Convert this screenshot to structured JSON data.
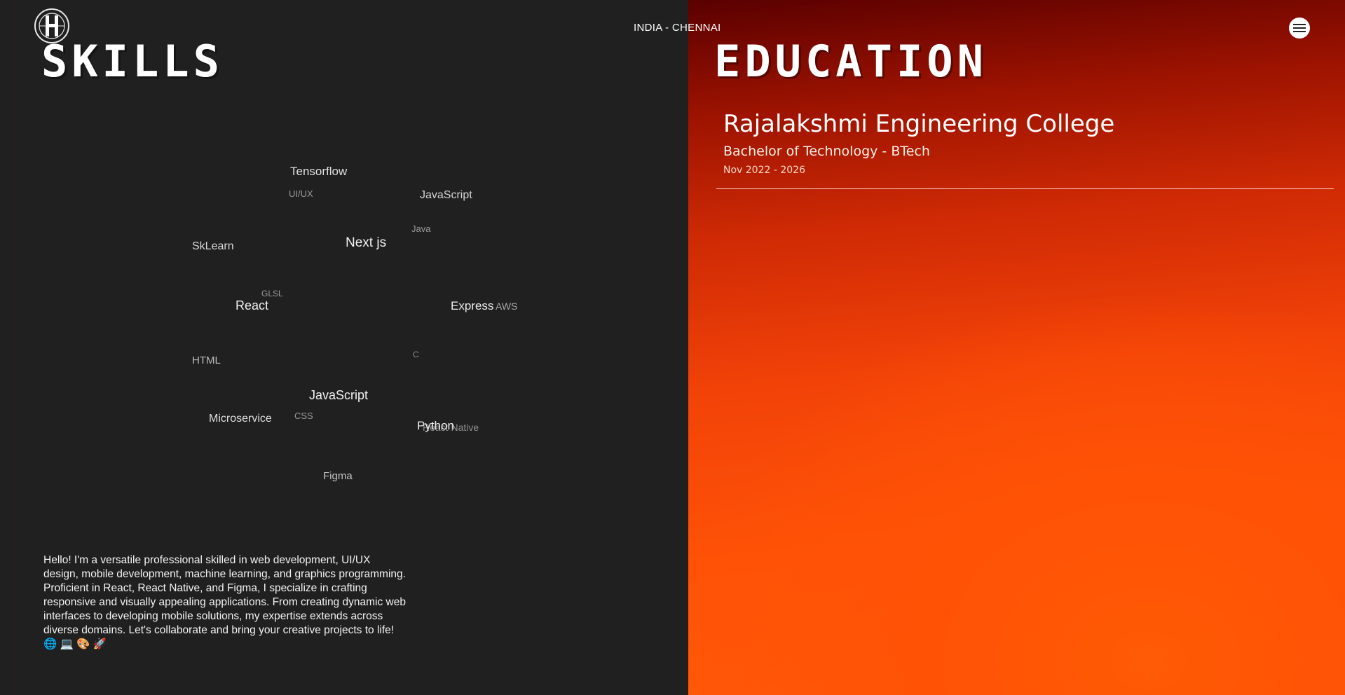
{
  "header": {
    "location": "INDIA - CHENNAI",
    "menu_icon": "hamburger-menu-icon",
    "logo_icon": "h-monogram-logo"
  },
  "skills": {
    "title": "SKILLS",
    "cloud": [
      {
        "label": "Tensorflow",
        "emphasis": "medium"
      },
      {
        "label": "UI/UX",
        "emphasis": "low"
      },
      {
        "label": "JavaScript",
        "emphasis": "medium"
      },
      {
        "label": "Java",
        "emphasis": "low"
      },
      {
        "label": "SkLearn",
        "emphasis": "medium"
      },
      {
        "label": "Next js",
        "emphasis": "high"
      },
      {
        "label": "GLSL",
        "emphasis": "low"
      },
      {
        "label": "React",
        "emphasis": "high"
      },
      {
        "label": "Express",
        "emphasis": "high"
      },
      {
        "label": "AWS",
        "emphasis": "low"
      },
      {
        "label": "HTML",
        "emphasis": "medium"
      },
      {
        "label": "C",
        "emphasis": "low"
      },
      {
        "label": "JavaScript",
        "emphasis": "high"
      },
      {
        "label": "Microservice",
        "emphasis": "medium"
      },
      {
        "label": "CSS",
        "emphasis": "low"
      },
      {
        "label": "React Native",
        "emphasis": "low"
      },
      {
        "label": "Python",
        "emphasis": "high"
      },
      {
        "label": "Figma",
        "emphasis": "medium"
      }
    ],
    "about": "Hello! I'm a versatile professional skilled in web development, UI/UX design, mobile development, machine learning, and graphics programming. Proficient in React, React Native, and Figma, I specialize in crafting responsive and visually appealing applications. From creating dynamic web interfaces to developing mobile solutions, my expertise extends across diverse domains. Let's collaborate and bring your creative projects to life! 🌐 💻 🎨 🚀"
  },
  "education": {
    "title": "EDUCATION",
    "entries": [
      {
        "school": "Rajalakshmi Engineering College",
        "degree": "Bachelor of Technology - BTech",
        "dates": "Nov 2022 - 2026"
      }
    ]
  },
  "colors": {
    "left_bg": "#202020",
    "right_gradient_top": "#5a0000",
    "right_gradient_bottom": "#ff5a08",
    "text": "#ffffff"
  }
}
